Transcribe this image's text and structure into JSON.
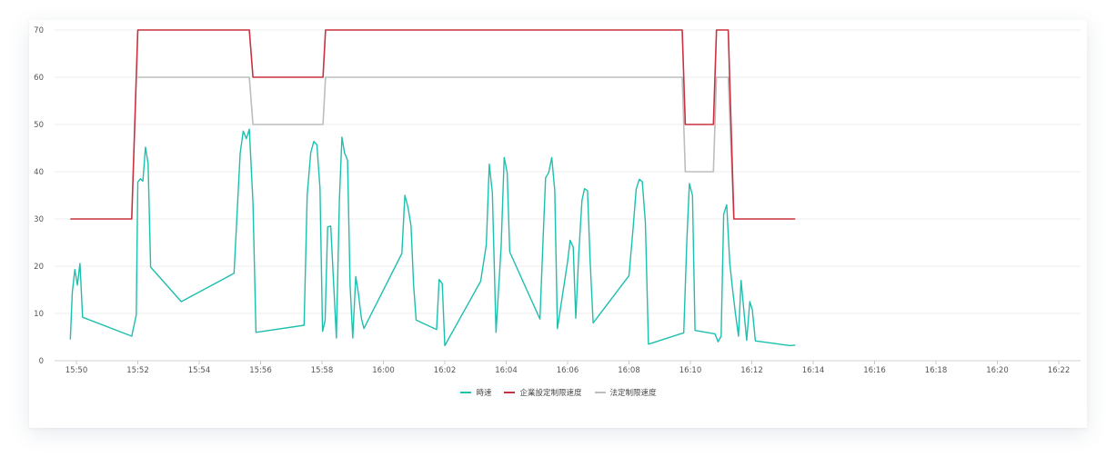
{
  "chart_data": {
    "type": "line",
    "y_ticks": [
      "0",
      "10",
      "20",
      "30",
      "40",
      "50",
      "60",
      "70"
    ],
    "x_ticks": [
      {
        "label": "15:50",
        "t": 0
      },
      {
        "label": "15:52",
        "t": 120
      },
      {
        "label": "15:54",
        "t": 240
      },
      {
        "label": "15:56",
        "t": 360
      },
      {
        "label": "15:58",
        "t": 480
      },
      {
        "label": "16:00",
        "t": 600
      },
      {
        "label": "16:02",
        "t": 720
      },
      {
        "label": "16:04",
        "t": 840
      },
      {
        "label": "16:06",
        "t": 960
      },
      {
        "label": "16:08",
        "t": 1080
      },
      {
        "label": "16:10",
        "t": 1200
      },
      {
        "label": "16:12",
        "t": 1320
      },
      {
        "label": "16:14",
        "t": 1440
      },
      {
        "label": "16:16",
        "t": 1560
      },
      {
        "label": "16:18",
        "t": 1680
      },
      {
        "label": "16:20",
        "t": 1800
      },
      {
        "label": "16:22",
        "t": 1920
      }
    ],
    "ylim": [
      0,
      70
    ],
    "grid": true,
    "legend_position": "bottom",
    "series": [
      {
        "name": "時速",
        "color": "#1fbfae",
        "points": [
          [
            -12,
            4.5
          ],
          [
            -8,
            14.5
          ],
          [
            -3,
            19.3
          ],
          [
            2,
            16
          ],
          [
            7,
            20.6
          ],
          [
            12,
            9.2
          ],
          [
            108,
            5.2
          ],
          [
            117,
            9.7
          ],
          [
            120,
            37.8
          ],
          [
            125,
            38.5
          ],
          [
            130,
            38
          ],
          [
            135,
            45.2
          ],
          [
            140,
            41.8
          ],
          [
            145,
            19.8
          ],
          [
            205,
            12.5
          ],
          [
            308,
            18.5
          ],
          [
            320,
            43.8
          ],
          [
            326,
            48.6
          ],
          [
            332,
            47
          ],
          [
            338,
            49
          ],
          [
            345,
            33.5
          ],
          [
            351,
            6
          ],
          [
            445,
            7.5
          ],
          [
            451,
            35
          ],
          [
            458,
            44
          ],
          [
            464,
            46.4
          ],
          [
            470,
            45.7
          ],
          [
            476,
            36.5
          ],
          [
            481,
            6.2
          ],
          [
            486,
            8.5
          ],
          [
            491,
            28.3
          ],
          [
            497,
            28.5
          ],
          [
            503,
            16
          ],
          [
            508,
            4.8
          ],
          [
            514,
            33.8
          ],
          [
            519,
            47.3
          ],
          [
            524,
            44
          ],
          [
            530,
            42.4
          ],
          [
            535,
            16
          ],
          [
            540,
            4.8
          ],
          [
            546,
            17.8
          ],
          [
            551,
            14.4
          ],
          [
            557,
            9
          ],
          [
            562,
            6.8
          ],
          [
            636,
            22.7
          ],
          [
            642,
            35
          ],
          [
            648,
            32.5
          ],
          [
            654,
            28.5
          ],
          [
            659,
            16
          ],
          [
            664,
            8.6
          ],
          [
            704,
            6.6
          ],
          [
            709,
            17.2
          ],
          [
            715,
            16.3
          ],
          [
            720,
            3.2
          ],
          [
            790,
            16.8
          ],
          [
            801,
            24.5
          ],
          [
            807,
            41.6
          ],
          [
            813,
            35.5
          ],
          [
            820,
            6
          ],
          [
            830,
            24
          ],
          [
            836,
            43
          ],
          [
            842,
            39.8
          ],
          [
            847,
            23
          ],
          [
            906,
            8.8
          ],
          [
            912,
            25.4
          ],
          [
            917,
            38.7
          ],
          [
            923,
            39.8
          ],
          [
            929,
            43
          ],
          [
            935,
            36
          ],
          [
            940,
            6.8
          ],
          [
            960,
            21
          ],
          [
            965,
            25.5
          ],
          [
            971,
            24
          ],
          [
            976,
            9
          ],
          [
            982,
            23
          ],
          [
            988,
            33.9
          ],
          [
            993,
            36.4
          ],
          [
            999,
            36
          ],
          [
            1004,
            21
          ],
          [
            1010,
            8
          ],
          [
            1080,
            18
          ],
          [
            1088,
            28
          ],
          [
            1094,
            36.3
          ],
          [
            1100,
            38.4
          ],
          [
            1106,
            37.9
          ],
          [
            1112,
            29.3
          ],
          [
            1118,
            3.5
          ],
          [
            1187,
            5.9
          ],
          [
            1193,
            25.4
          ],
          [
            1198,
            37.5
          ],
          [
            1204,
            35
          ],
          [
            1209,
            6.4
          ],
          [
            1248,
            5.7
          ],
          [
            1254,
            4
          ],
          [
            1260,
            5.2
          ],
          [
            1265,
            31
          ],
          [
            1271,
            33
          ],
          [
            1277,
            20.6
          ],
          [
            1282,
            15.6
          ],
          [
            1288,
            10
          ],
          [
            1294,
            5.2
          ],
          [
            1299,
            17
          ],
          [
            1305,
            10
          ],
          [
            1310,
            4.3
          ],
          [
            1316,
            12.5
          ],
          [
            1321,
            10.8
          ],
          [
            1327,
            4.2
          ],
          [
            1395,
            3.2
          ],
          [
            1405,
            3.3
          ]
        ]
      },
      {
        "name": "企業設定制限速度",
        "color": "#c8323f",
        "points": [
          [
            -12,
            30
          ],
          [
            108,
            30
          ],
          [
            120,
            70
          ],
          [
            338,
            70
          ],
          [
            345,
            60
          ],
          [
            482,
            60
          ],
          [
            487,
            70
          ],
          [
            1184,
            70
          ],
          [
            1190,
            50
          ],
          [
            1245,
            50
          ],
          [
            1251,
            70
          ],
          [
            1274,
            70
          ],
          [
            1285,
            30
          ],
          [
            1405,
            30
          ]
        ]
      },
      {
        "name": "法定制限速度",
        "color": "#bdbdbd",
        "points": [
          [
            120,
            60
          ],
          [
            338,
            60
          ],
          [
            345,
            50
          ],
          [
            482,
            50
          ],
          [
            487,
            60
          ],
          [
            1184,
            60
          ],
          [
            1190,
            40
          ],
          [
            1245,
            40
          ],
          [
            1251,
            60
          ],
          [
            1274,
            60
          ],
          [
            1285,
            30
          ]
        ]
      }
    ]
  }
}
